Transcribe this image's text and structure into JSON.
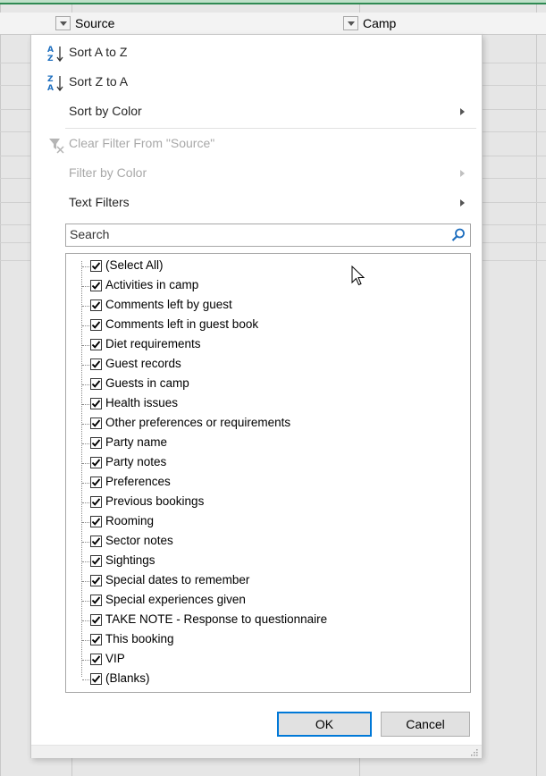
{
  "sheet": {
    "columns": [
      {
        "header": "Source"
      },
      {
        "header": "Camp"
      }
    ]
  },
  "menu": {
    "sort_az": "Sort A to Z",
    "sort_za": "Sort Z to A",
    "sort_by_color": "Sort by Color",
    "clear_filter": "Clear Filter From \"Source\"",
    "filter_by_color": "Filter by Color",
    "text_filters": "Text Filters"
  },
  "search": {
    "placeholder": "Search"
  },
  "list": {
    "items": [
      {
        "label": "(Select All)",
        "checked": true
      },
      {
        "label": "Activities in camp",
        "checked": true
      },
      {
        "label": "Comments left by guest",
        "checked": true
      },
      {
        "label": "Comments left in guest book",
        "checked": true
      },
      {
        "label": "Diet requirements",
        "checked": true
      },
      {
        "label": "Guest records",
        "checked": true
      },
      {
        "label": "Guests in camp",
        "checked": true
      },
      {
        "label": "Health issues",
        "checked": true
      },
      {
        "label": "Other preferences or requirements",
        "checked": true
      },
      {
        "label": "Party name",
        "checked": true
      },
      {
        "label": "Party notes",
        "checked": true
      },
      {
        "label": "Preferences",
        "checked": true
      },
      {
        "label": "Previous bookings",
        "checked": true
      },
      {
        "label": "Rooming",
        "checked": true
      },
      {
        "label": "Sector notes",
        "checked": true
      },
      {
        "label": "Sightings",
        "checked": true
      },
      {
        "label": "Special dates to remember",
        "checked": true
      },
      {
        "label": "Special experiences given",
        "checked": true
      },
      {
        "label": "TAKE NOTE - Response to questionnaire",
        "checked": true
      },
      {
        "label": "This booking",
        "checked": true
      },
      {
        "label": "VIP",
        "checked": true
      },
      {
        "label": "(Blanks)",
        "checked": true
      }
    ]
  },
  "buttons": {
    "ok": "OK",
    "cancel": "Cancel"
  },
  "icons": {
    "sort_az": "sort-ascending-icon",
    "sort_za": "sort-descending-icon",
    "clear_filter": "clear-filter-icon",
    "search": "magnifier-icon",
    "submenu": "chevron-right-icon"
  },
  "colors": {
    "accent": "#0078d7",
    "sheet_green": "#2f8a53",
    "disabled_text": "#a8a8a8"
  }
}
